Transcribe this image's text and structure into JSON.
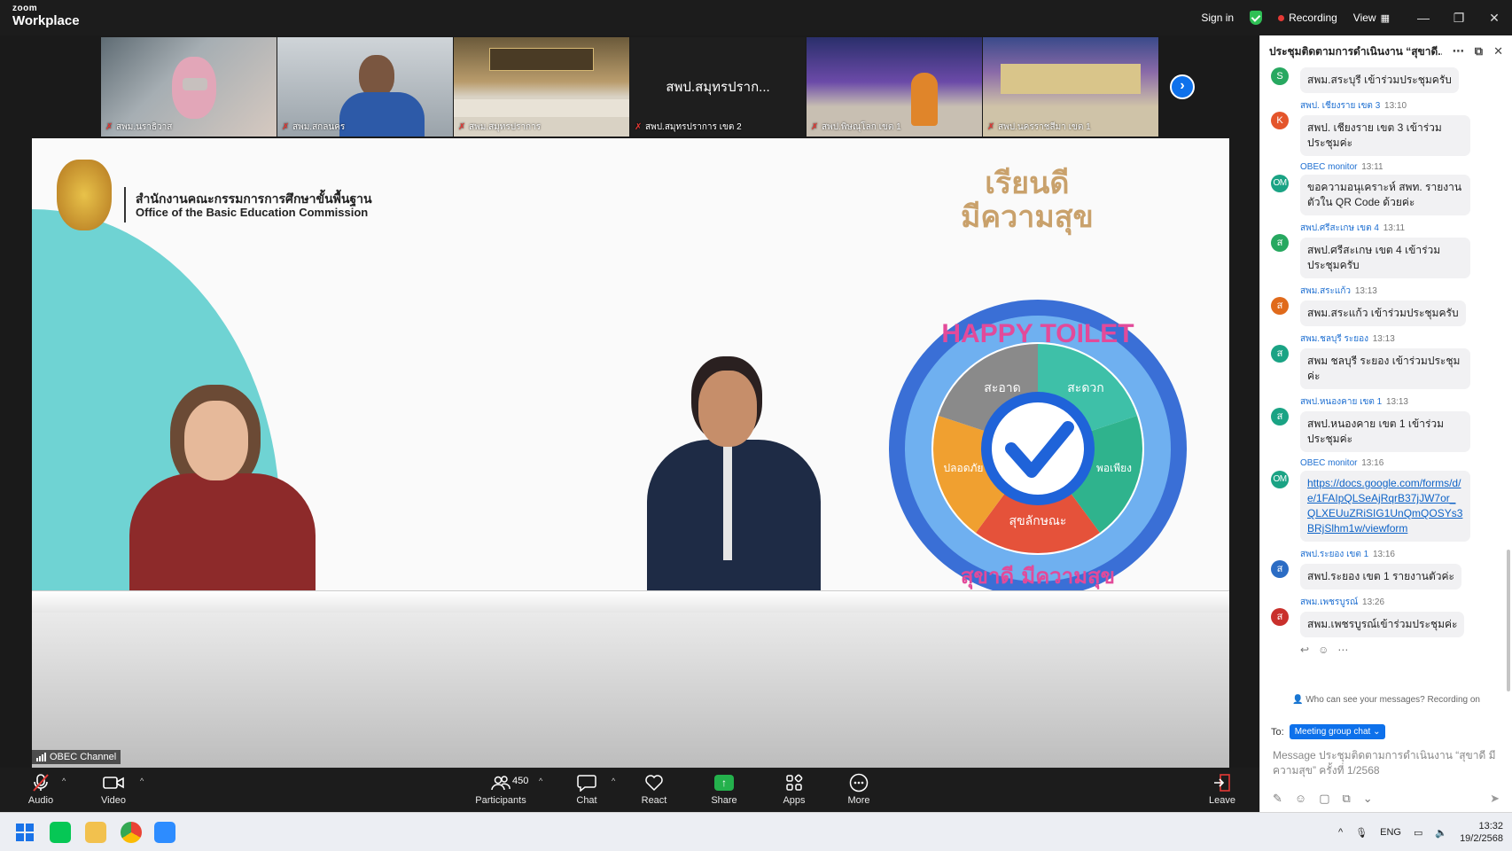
{
  "app": {
    "brand_top": "zoom",
    "brand_bottom": "Workplace"
  },
  "topbar": {
    "sign_in": "Sign in",
    "recording": "Recording",
    "view": "View"
  },
  "thumbnails": [
    {
      "label": "สพม.นราธิวาส"
    },
    {
      "label": "สพม.สกลนคร"
    },
    {
      "label": "สพม.สมุทรปราการ"
    },
    {
      "label": "สพป.สมุทรปราการ เขต 2",
      "center_name": "สพป.สมุทรปราก..."
    },
    {
      "label": "สพป.พิษณุโลก เขต 1"
    },
    {
      "label": "สพป.นครราชสีมา เขต 1"
    }
  ],
  "stage": {
    "org_th": "สำนักงานคณะกรรมการการศึกษาขั้นพื้นฐาน",
    "org_en": "Office of the Basic Education Commission",
    "slogan_line1": "เรียนดี",
    "slogan_line2": "มีความสุข",
    "badge_top": "HAPPY TOILET",
    "badge_bottom": "สุขาดี มีความสุข",
    "badge_segments": [
      "สะอาด",
      "สะดวก",
      "ปลอดภัย",
      "สุขลักษณะ",
      "พอเพียง"
    ],
    "channel_label": "OBEC Channel"
  },
  "toolbar": {
    "audio": "Audio",
    "video": "Video",
    "participants": "Participants",
    "participants_count": "450",
    "chat": "Chat",
    "react": "React",
    "share": "Share",
    "apps": "Apps",
    "more": "More",
    "leave": "Leave"
  },
  "chat": {
    "title": "ประชุมติดตามการดำเนินงาน “สุขาดี...",
    "messages": [
      {
        "avatar": "S",
        "color": "#27a860",
        "sender": "",
        "time": "",
        "text": "สพม.สระบุรี เข้าร่วมประชุมครับ",
        "link": false
      },
      {
        "avatar": "K",
        "color": "#e4552b",
        "sender": "สพป. เชียงราย เขต 3",
        "time": "13:10",
        "text": "สพป. เชียงราย เขต 3 เข้าร่วมประชุมค่ะ",
        "link": false
      },
      {
        "avatar": "OM",
        "color": "#1aa384",
        "sender": "OBEC monitor",
        "time": "13:11",
        "text": "ขอความอนุเคราะห์ สพท. รายงานตัวใน QR Code ด้วยค่ะ",
        "link": false
      },
      {
        "avatar": "ส",
        "color": "#27a860",
        "sender": "สพป.ศรีสะเกษ เขต 4",
        "time": "13:11",
        "text": "สพป.ศรีสะเกษ เขต 4 เข้าร่วมประชุมครับ",
        "link": false
      },
      {
        "avatar": "ส",
        "color": "#e06a1b",
        "sender": "สพม.สระแก้ว",
        "time": "13:13",
        "text": "สพม.สระแก้ว เข้าร่วมประชุมครับ",
        "link": false
      },
      {
        "avatar": "ส",
        "color": "#1aa384",
        "sender": "สพม.ชลบุรี ระยอง",
        "time": "13:13",
        "text": "สพม ชลบุรี ระยอง เข้าร่วมประชุมค่ะ",
        "link": false
      },
      {
        "avatar": "ส",
        "color": "#1aa384",
        "sender": "สพป.หนองคาย เขต 1",
        "time": "13:13",
        "text": "สพป.หนองคาย เขต 1 เข้าร่วมประชุมค่ะ",
        "link": false
      },
      {
        "avatar": "OM",
        "color": "#1aa384",
        "sender": "OBEC monitor",
        "time": "13:16",
        "text": "https://docs.google.com/forms/d/e/1FAIpQLSeAjRqrB37jJW7or_QLXEUuZRiSIG1UnQmQOSYs3BRjSlhm1w/viewform",
        "link": true
      },
      {
        "avatar": "ส",
        "color": "#2b6cc4",
        "sender": "สพป.ระยอง เขต 1",
        "time": "13:16",
        "text": "สพป.ระยอง เขต 1 รายงานตัวค่ะ",
        "link": false
      },
      {
        "avatar": "ส",
        "color": "#c9302c",
        "sender": "สพม.เพชรบูรณ์",
        "time": "13:26",
        "text": "สพม.เพชรบูรณ์เข้าร่วมประชุมค่ะ",
        "link": false
      }
    ],
    "privacy_note": "Who can see your messages? Recording on",
    "to_label": "To:",
    "to_value": "Meeting group chat",
    "compose_placeholder": "Message ประชุมติดตามการดำเนินงาน “สุขาดี มีความสุข” ครั้งที่ 1/2568"
  },
  "taskbar": {
    "lang": "ENG",
    "time": "13:32",
    "date": "19/2/2568"
  }
}
